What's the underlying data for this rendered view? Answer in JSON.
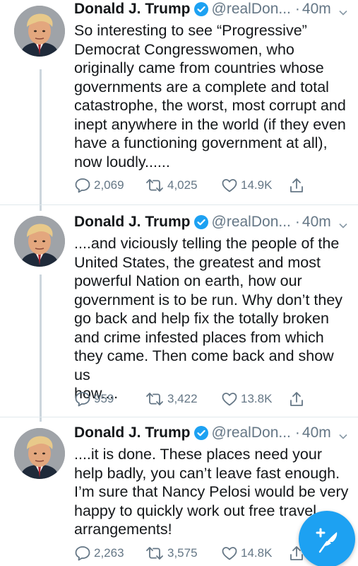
{
  "tweets": [
    {
      "name": "Donald J. Trump",
      "handle": "@realDon...",
      "separator": "·",
      "time": "40m",
      "text": "So interesting to see “Progressive”\nDemocrat Congresswomen, who\noriginally came from countries whose\ngovernments are a complete and total\ncatastrophe, the worst, most corrupt and\ninept anywhere in the world (if they even\nhave a functioning government at all),\nnow loudly......",
      "replies": "2,069",
      "retweets": "4,025",
      "likes": "14.9K"
    },
    {
      "name": "Donald J. Trump",
      "handle": "@realDon...",
      "separator": "·",
      "time": "40m",
      "text": "....and viciously telling the people of the\nUnited States, the greatest and most\npowerful Nation on earth, how our\ngovernment is to be run. Why don’t they\ngo back and help fix the totally broken\nand crime infested places from which\nthey came. Then come back and show us\nhow....",
      "replies": "959",
      "retweets": "3,422",
      "likes": "13.8K"
    },
    {
      "name": "Donald J. Trump",
      "handle": "@realDon...",
      "separator": "·",
      "time": "40m",
      "text": "....it is done. These places need your\nhelp badly, you can’t leave fast enough.\nI’m sure that Nancy Pelosi would be very\nhappy to quickly work out free travel\narrangements!",
      "replies": "2,263",
      "retweets": "3,575",
      "likes": "14.8K"
    }
  ],
  "icons": {
    "verified": "verified-badge-icon",
    "caret": "chevron-down-icon",
    "reply": "reply-bubble-icon",
    "retweet": "retweet-icon",
    "like": "heart-icon",
    "share": "share-icon",
    "compose": "compose-tweet-icon"
  },
  "colors": {
    "accent": "#1da1f2",
    "text": "#14171a",
    "muted": "#657786",
    "thread_line": "#ccd6dd"
  }
}
